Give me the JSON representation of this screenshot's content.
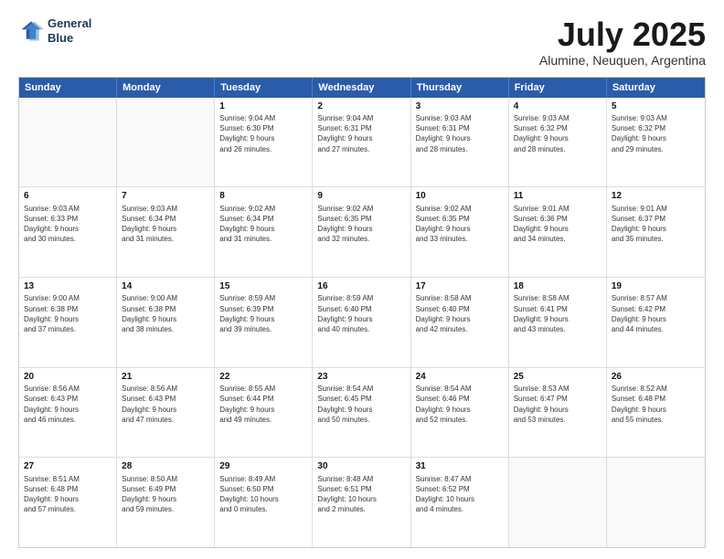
{
  "header": {
    "logo_line1": "General",
    "logo_line2": "Blue",
    "title": "July 2025",
    "subtitle": "Alumine, Neuquen, Argentina"
  },
  "calendar": {
    "weekdays": [
      "Sunday",
      "Monday",
      "Tuesday",
      "Wednesday",
      "Thursday",
      "Friday",
      "Saturday"
    ],
    "rows": [
      [
        {
          "day": "",
          "empty": true
        },
        {
          "day": "",
          "empty": true
        },
        {
          "day": "1",
          "lines": [
            "Sunrise: 9:04 AM",
            "Sunset: 6:30 PM",
            "Daylight: 9 hours",
            "and 26 minutes."
          ]
        },
        {
          "day": "2",
          "lines": [
            "Sunrise: 9:04 AM",
            "Sunset: 6:31 PM",
            "Daylight: 9 hours",
            "and 27 minutes."
          ]
        },
        {
          "day": "3",
          "lines": [
            "Sunrise: 9:03 AM",
            "Sunset: 6:31 PM",
            "Daylight: 9 hours",
            "and 28 minutes."
          ]
        },
        {
          "day": "4",
          "lines": [
            "Sunrise: 9:03 AM",
            "Sunset: 6:32 PM",
            "Daylight: 9 hours",
            "and 28 minutes."
          ]
        },
        {
          "day": "5",
          "lines": [
            "Sunrise: 9:03 AM",
            "Sunset: 6:32 PM",
            "Daylight: 9 hours",
            "and 29 minutes."
          ]
        }
      ],
      [
        {
          "day": "6",
          "lines": [
            "Sunrise: 9:03 AM",
            "Sunset: 6:33 PM",
            "Daylight: 9 hours",
            "and 30 minutes."
          ]
        },
        {
          "day": "7",
          "lines": [
            "Sunrise: 9:03 AM",
            "Sunset: 6:34 PM",
            "Daylight: 9 hours",
            "and 31 minutes."
          ]
        },
        {
          "day": "8",
          "lines": [
            "Sunrise: 9:02 AM",
            "Sunset: 6:34 PM",
            "Daylight: 9 hours",
            "and 31 minutes."
          ]
        },
        {
          "day": "9",
          "lines": [
            "Sunrise: 9:02 AM",
            "Sunset: 6:35 PM",
            "Daylight: 9 hours",
            "and 32 minutes."
          ]
        },
        {
          "day": "10",
          "lines": [
            "Sunrise: 9:02 AM",
            "Sunset: 6:35 PM",
            "Daylight: 9 hours",
            "and 33 minutes."
          ]
        },
        {
          "day": "11",
          "lines": [
            "Sunrise: 9:01 AM",
            "Sunset: 6:36 PM",
            "Daylight: 9 hours",
            "and 34 minutes."
          ]
        },
        {
          "day": "12",
          "lines": [
            "Sunrise: 9:01 AM",
            "Sunset: 6:37 PM",
            "Daylight: 9 hours",
            "and 35 minutes."
          ]
        }
      ],
      [
        {
          "day": "13",
          "lines": [
            "Sunrise: 9:00 AM",
            "Sunset: 6:38 PM",
            "Daylight: 9 hours",
            "and 37 minutes."
          ]
        },
        {
          "day": "14",
          "lines": [
            "Sunrise: 9:00 AM",
            "Sunset: 6:38 PM",
            "Daylight: 9 hours",
            "and 38 minutes."
          ]
        },
        {
          "day": "15",
          "lines": [
            "Sunrise: 8:59 AM",
            "Sunset: 6:39 PM",
            "Daylight: 9 hours",
            "and 39 minutes."
          ]
        },
        {
          "day": "16",
          "lines": [
            "Sunrise: 8:59 AM",
            "Sunset: 6:40 PM",
            "Daylight: 9 hours",
            "and 40 minutes."
          ]
        },
        {
          "day": "17",
          "lines": [
            "Sunrise: 8:58 AM",
            "Sunset: 6:40 PM",
            "Daylight: 9 hours",
            "and 42 minutes."
          ]
        },
        {
          "day": "18",
          "lines": [
            "Sunrise: 8:58 AM",
            "Sunset: 6:41 PM",
            "Daylight: 9 hours",
            "and 43 minutes."
          ]
        },
        {
          "day": "19",
          "lines": [
            "Sunrise: 8:57 AM",
            "Sunset: 6:42 PM",
            "Daylight: 9 hours",
            "and 44 minutes."
          ]
        }
      ],
      [
        {
          "day": "20",
          "lines": [
            "Sunrise: 8:56 AM",
            "Sunset: 6:43 PM",
            "Daylight: 9 hours",
            "and 46 minutes."
          ]
        },
        {
          "day": "21",
          "lines": [
            "Sunrise: 8:56 AM",
            "Sunset: 6:43 PM",
            "Daylight: 9 hours",
            "and 47 minutes."
          ]
        },
        {
          "day": "22",
          "lines": [
            "Sunrise: 8:55 AM",
            "Sunset: 6:44 PM",
            "Daylight: 9 hours",
            "and 49 minutes."
          ]
        },
        {
          "day": "23",
          "lines": [
            "Sunrise: 8:54 AM",
            "Sunset: 6:45 PM",
            "Daylight: 9 hours",
            "and 50 minutes."
          ]
        },
        {
          "day": "24",
          "lines": [
            "Sunrise: 8:54 AM",
            "Sunset: 6:46 PM",
            "Daylight: 9 hours",
            "and 52 minutes."
          ]
        },
        {
          "day": "25",
          "lines": [
            "Sunrise: 8:53 AM",
            "Sunset: 6:47 PM",
            "Daylight: 9 hours",
            "and 53 minutes."
          ]
        },
        {
          "day": "26",
          "lines": [
            "Sunrise: 8:52 AM",
            "Sunset: 6:48 PM",
            "Daylight: 9 hours",
            "and 55 minutes."
          ]
        }
      ],
      [
        {
          "day": "27",
          "lines": [
            "Sunrise: 8:51 AM",
            "Sunset: 6:48 PM",
            "Daylight: 9 hours",
            "and 57 minutes."
          ]
        },
        {
          "day": "28",
          "lines": [
            "Sunrise: 8:50 AM",
            "Sunset: 6:49 PM",
            "Daylight: 9 hours",
            "and 59 minutes."
          ]
        },
        {
          "day": "29",
          "lines": [
            "Sunrise: 8:49 AM",
            "Sunset: 6:50 PM",
            "Daylight: 10 hours",
            "and 0 minutes."
          ]
        },
        {
          "day": "30",
          "lines": [
            "Sunrise: 8:48 AM",
            "Sunset: 6:51 PM",
            "Daylight: 10 hours",
            "and 2 minutes."
          ]
        },
        {
          "day": "31",
          "lines": [
            "Sunrise: 8:47 AM",
            "Sunset: 6:52 PM",
            "Daylight: 10 hours",
            "and 4 minutes."
          ]
        },
        {
          "day": "",
          "empty": true
        },
        {
          "day": "",
          "empty": true
        }
      ]
    ]
  }
}
